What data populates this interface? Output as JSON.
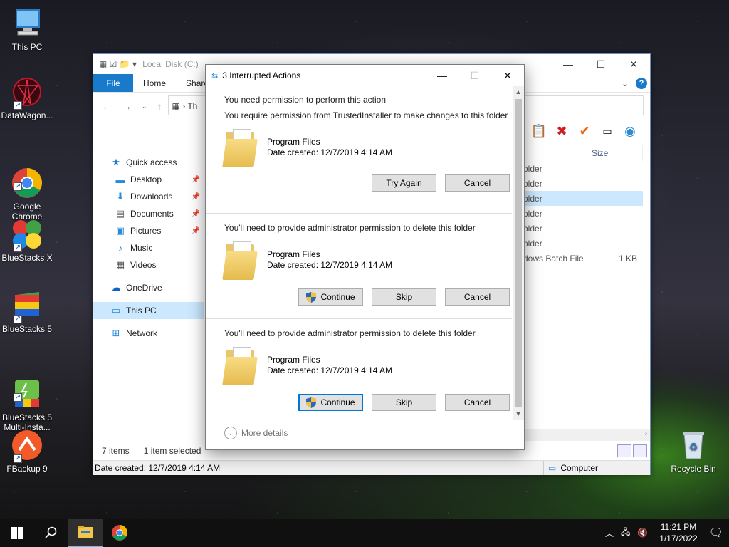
{
  "desktop": {
    "icons": [
      {
        "label": "This PC"
      },
      {
        "label": "DataWagon..."
      },
      {
        "label": "Google\nChrome"
      },
      {
        "label": "BlueStacks X"
      },
      {
        "label": "BlueStacks 5"
      },
      {
        "label": "BlueStacks 5\nMulti-Insta..."
      },
      {
        "label": "FBackup 9"
      },
      {
        "label": "Recycle Bin"
      }
    ]
  },
  "explorer": {
    "title": "Local Disk (C:)",
    "ribbon": {
      "file": "File",
      "home": "Home",
      "share": "Share"
    },
    "address_partial": "Th",
    "nav": {
      "quick_access": "Quick access",
      "desktop": "Desktop",
      "downloads": "Downloads",
      "documents": "Documents",
      "pictures": "Pictures",
      "music": "Music",
      "videos": "Videos",
      "onedrive": "OneDrive",
      "this_pc": "This PC",
      "network": "Network"
    },
    "column_size": "Size",
    "rows": [
      {
        "type": "older",
        "size": ""
      },
      {
        "type": "older",
        "size": ""
      },
      {
        "type": "older",
        "size": ""
      },
      {
        "type": "older",
        "size": ""
      },
      {
        "type": "older",
        "size": ""
      },
      {
        "type": "older",
        "size": ""
      },
      {
        "type": "dows Batch File",
        "size": "1 KB"
      }
    ],
    "status": {
      "items": "7 items",
      "selected": "1 item selected"
    },
    "details": {
      "date": "Date created: 12/7/2019 4:14 AM",
      "computer": "Computer"
    }
  },
  "dialog": {
    "title": "3 Interrupted Actions",
    "sections": [
      {
        "head1": "You need permission to perform this action",
        "head2": "You require permission from TrustedInstaller to make changes to this folder",
        "name": "Program Files",
        "date": "Date created: 12/7/2019 4:14 AM",
        "btn1": "Try Again",
        "btn2": "Cancel"
      },
      {
        "head": "You'll need to provide administrator permission to delete this folder",
        "name": "Program Files",
        "date": "Date created: 12/7/2019 4:14 AM",
        "btn1": "Continue",
        "btn2": "Skip",
        "btn3": "Cancel"
      },
      {
        "head": "You'll need to provide administrator permission to delete this folder",
        "name": "Program Files",
        "date": "Date created: 12/7/2019 4:14 AM",
        "btn1": "Continue",
        "btn2": "Skip",
        "btn3": "Cancel"
      }
    ],
    "more_details": "More details"
  },
  "taskbar": {
    "time": "11:21 PM",
    "date": "1/17/2022"
  },
  "colors": {
    "accent": "#1979ca",
    "selection": "#cce8ff"
  }
}
